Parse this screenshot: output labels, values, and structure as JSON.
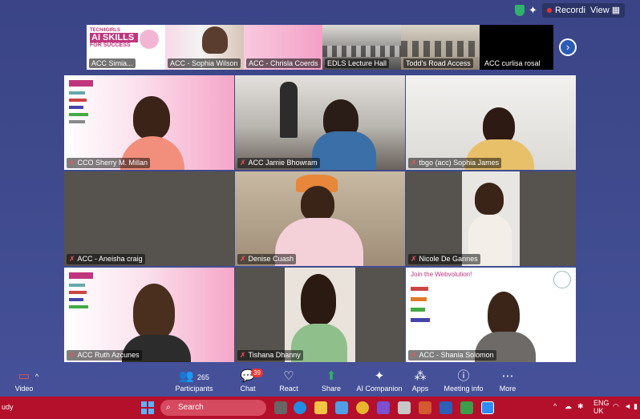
{
  "topbar": {
    "recording": "Recording",
    "view": "View"
  },
  "strip": [
    {
      "label": "ACC Simia...",
      "banner_small": "TECH4GIRLS",
      "banner_big": "AI SKILLS",
      "banner_sub": "FOR SUCCESS"
    },
    {
      "label": "ACC - Sophia Wilson"
    },
    {
      "label": "ACC - Chrisla Coerds"
    },
    {
      "label": "EDLS Lecture Hall"
    },
    {
      "label": "Todd's Road Access"
    },
    {
      "label": "ACC curlisa rosal"
    }
  ],
  "grid": [
    {
      "name": "CCO Sherry M. Millan"
    },
    {
      "name": "ACC Jamie Bhowram"
    },
    {
      "name": "tbgo (acc) Sophia James"
    },
    {
      "name": "ACC - Aneisha craig"
    },
    {
      "name": "Denise Cuash"
    },
    {
      "name": "Nicole De Gannes"
    },
    {
      "name": "ACC Ruth Azcunes"
    },
    {
      "name": "Tishana Dhanny"
    },
    {
      "name": "ACC - Shania Solomon",
      "slide_title": "Join the Webvolution!"
    }
  ],
  "toolbar": {
    "video": "Video",
    "participants": "Participants",
    "participants_count": "265",
    "chat": "Chat",
    "chat_badge": "39",
    "react": "React",
    "share": "Share",
    "ai_companion": "AI Companion",
    "apps": "Apps",
    "meeting_info": "Meeting info",
    "more": "More"
  },
  "taskbar": {
    "left_text": "udy",
    "search": "Search",
    "lang": "ENG",
    "region": "UK"
  }
}
